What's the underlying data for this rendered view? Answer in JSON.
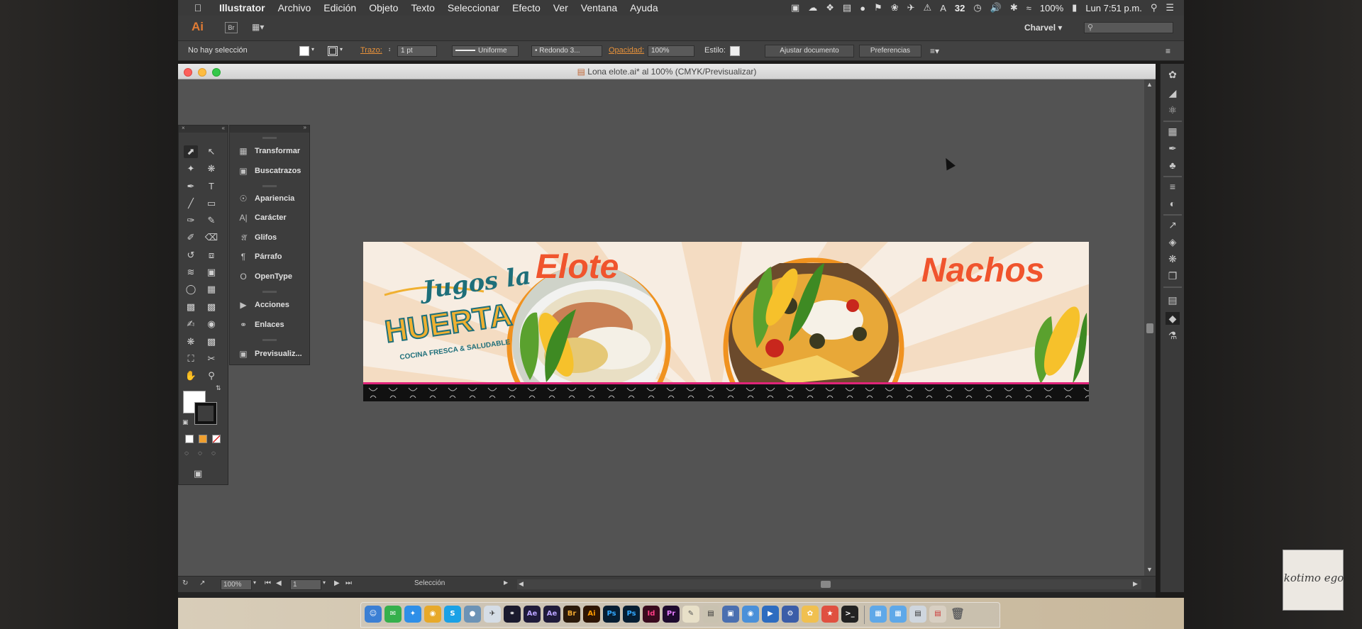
{
  "menubar": {
    "app": "Illustrator",
    "items": [
      "Archivo",
      "Edición",
      "Objeto",
      "Texto",
      "Seleccionar",
      "Efecto",
      "Ver",
      "Ventana",
      "Ayuda"
    ],
    "badge_count": "32",
    "battery": "100%",
    "clock": "Lun 7:51 p.m."
  },
  "appbar": {
    "logo": "Ai",
    "bridge": "Br",
    "workspace": "Charvel"
  },
  "control": {
    "selection": "No hay selección",
    "stroke_label": "Trazo:",
    "stroke_value": "1 pt",
    "stroke_style": "Uniforme",
    "brush": "Redondo 3...",
    "opacity_label": "Opacidad:",
    "opacity_value": "100%",
    "style_label": "Estilo:",
    "adjust_doc": "Ajustar documento",
    "preferences": "Preferencias"
  },
  "document": {
    "title": "Lona elote.ai* al 100% (CMYK/Previsualizar)",
    "zoom": "100%",
    "artboard": "1",
    "status": "Selección"
  },
  "panels": {
    "items": [
      {
        "label": "Transformar",
        "icon": "transform-icon"
      },
      {
        "label": "Buscatrazos",
        "icon": "pathfinder-icon"
      },
      {
        "label": "Apariencia",
        "icon": "appearance-icon"
      },
      {
        "label": "Carácter",
        "icon": "character-icon"
      },
      {
        "label": "Glifos",
        "icon": "glyphs-icon"
      },
      {
        "label": "Párrafo",
        "icon": "paragraph-icon"
      },
      {
        "label": "OpenType",
        "icon": "opentype-icon"
      },
      {
        "label": "Acciones",
        "icon": "actions-icon"
      },
      {
        "label": "Enlaces",
        "icon": "links-icon"
      },
      {
        "label": "Previsualiz...",
        "icon": "preview-icon"
      }
    ]
  },
  "artwork": {
    "brand_top": "Jugos la",
    "brand_main": "HUERTA",
    "brand_tagline": "COCINA FRESCA & SALUDABLE",
    "heading_left": "Elote",
    "heading_right": "Nachos",
    "colors": {
      "accent": "#f0542d",
      "ring": "#f0921f",
      "teal": "#1e6f7a",
      "bar": "#111111",
      "pink": "#e0247a"
    }
  },
  "dock": {
    "apps": [
      "Ae",
      "Ae",
      "Br",
      "Ai",
      "Ps",
      "Ps",
      "Id",
      "Pr"
    ]
  },
  "watermark": {
    "text": "kotimo ego"
  }
}
